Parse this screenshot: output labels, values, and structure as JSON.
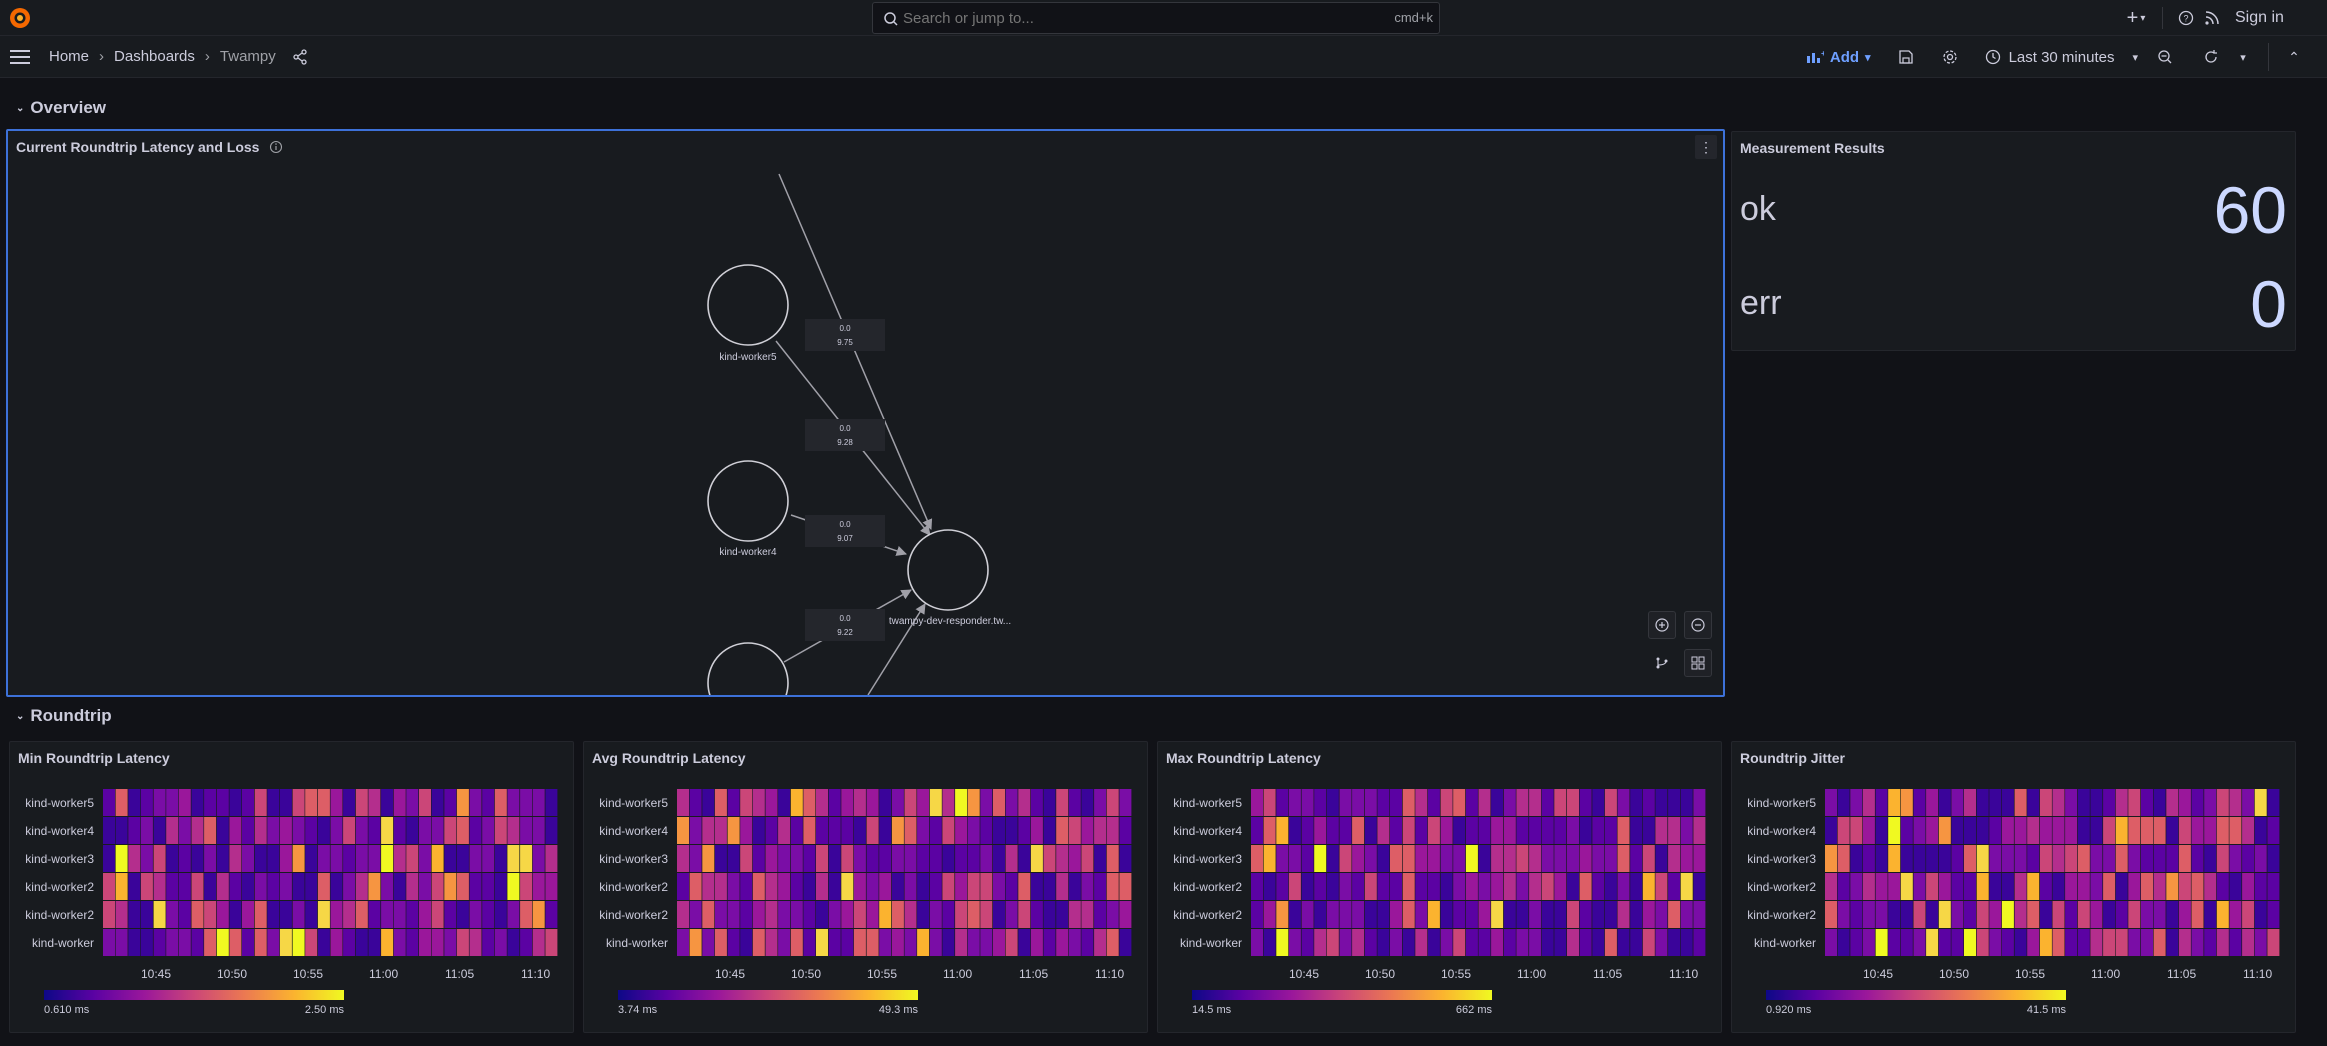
{
  "topbar": {
    "search_placeholder": "Search or jump to...",
    "shortcut": "cmd+k",
    "signin": "Sign in"
  },
  "breadcrumb": {
    "home": "Home",
    "dashboards": "Dashboards",
    "current": "Twampy"
  },
  "toolbar": {
    "add_label": "Add",
    "time_range": "Last 30 minutes"
  },
  "rows": {
    "overview": "Overview",
    "roundtrip": "Roundtrip"
  },
  "nodegraph": {
    "title": "Current Roundtrip Latency and Loss",
    "nodes": [
      {
        "label": "kind-worker5"
      },
      {
        "label": "kind-worker4"
      },
      {
        "label": "twampy-dev-responder.tw..."
      }
    ],
    "edges": [
      {
        "loss": "0.0",
        "latency": "9.75"
      },
      {
        "loss": "0.0",
        "latency": "9.28"
      },
      {
        "loss": "0.0",
        "latency": "9.07"
      },
      {
        "loss": "0.0",
        "latency": "9.22"
      }
    ]
  },
  "measurement": {
    "title": "Measurement Results",
    "ok_label": "ok",
    "ok_value": "60",
    "err_label": "err",
    "err_value": "0"
  },
  "heatmaps": [
    {
      "title": "Min Roundtrip Latency",
      "legend_min": "0.610 ms",
      "legend_max": "2.50 ms"
    },
    {
      "title": "Avg Roundtrip Latency",
      "legend_min": "3.74 ms",
      "legend_max": "49.3 ms"
    },
    {
      "title": "Max Roundtrip Latency",
      "legend_min": "14.5 ms",
      "legend_max": "662 ms"
    },
    {
      "title": "Roundtrip Jitter",
      "legend_min": "0.920 ms",
      "legend_max": "41.5 ms"
    }
  ],
  "heatmap_rows": [
    "kind-worker5",
    "kind-worker4",
    "kind-worker3",
    "kind-worker2",
    "kind-worker2",
    "kind-worker"
  ],
  "heatmap_ticks": [
    "10:45",
    "10:50",
    "10:55",
    "11:00",
    "11:05",
    "11:10"
  ],
  "colors": {
    "accent": "#6e9fff",
    "panel_bg": "#181b1f",
    "page_bg": "#111217",
    "selected_border": "#3d71d9"
  }
}
